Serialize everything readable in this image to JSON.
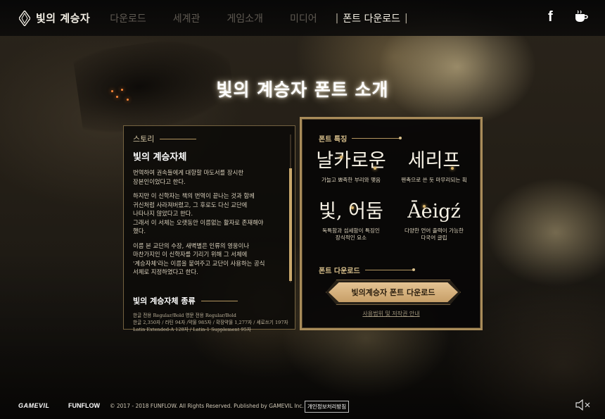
{
  "header": {
    "logo_text": "빛의 계승자",
    "menu": [
      {
        "label": "다운로드"
      },
      {
        "label": "세계관"
      },
      {
        "label": "게임소개"
      },
      {
        "label": "미디어"
      }
    ],
    "active_separator": "|",
    "active_label": "폰트 다운로드",
    "facebook_label": "f"
  },
  "page_title": "빛의 계승자 폰트 소개",
  "story": {
    "heading": "스토리",
    "subtitle": "빛의 계승자체",
    "paragraph_1": "번역하여 권속들에게 대항할 마도서를 장시한\n장본인이었다고 한다.",
    "paragraph_2": "하지만 이 신학자는 책의 번역이 끝나는 것과 함께\n귀신처럼 사라져버렸고, 그 후로도 다신 교단에\n나타나지 않았다고 한다.\n그래서 이 서체는 오랫동안 이름없는 활자로 존재해야\n했다.",
    "paragraph_3": "이름 본 교단의 수장, 새벽별은 인류의 영웅이나\n마찬가지인 이 신학자를 기리기 위해 그 서체에\n'계승자체'라는 이름을 붙여주고 교단이 사용하는 공식\n서체로 지정하였다고 한다."
  },
  "types": {
    "heading": "빛의 계승자체 종류",
    "line_1": "한글 전용 Regular/Bold 영문 전용 Regular/Bold",
    "line_2": "한글 2,350자 / 라틴 94자 /약물 985자 / 확장약물 1,277자 / 세로쓰기 197자",
    "line_3": "Latin Extended-A 128자 / Latin-1 Supplement 95자"
  },
  "features": {
    "heading": "폰트 특징",
    "items": [
      {
        "glyph": "날카로운",
        "desc": "가늘고 뾰족한 부리와 맺음"
      },
      {
        "glyph": "세리프",
        "desc": "펜촉으로 쓴 듯 마무리되는 획"
      },
      {
        "glyph": "빛, 어둠",
        "desc": "독특함과 섬세함이 특징인\n장식적인 요소"
      },
      {
        "glyph": "Āeigź",
        "desc": "다양한 언어 출력이 가능한\n다국어 글립"
      }
    ],
    "download_heading": "폰트 다운로드",
    "download_button": "빛의계승자 폰트 다운로드",
    "license_link": "사용범위 및 저작권 안내"
  },
  "footer": {
    "gamevil": "GAMEVIL",
    "funflow": "FUNFLOW",
    "copyright": "© 2017 - 2018 FUNFLOW. All Rights Reserved. Published by GAMEVIL Inc.",
    "privacy": "개인정보처리방침"
  },
  "colors": {
    "accent_gold": "#c79f68",
    "nav_inactive": "#5f5a52",
    "panel_border": "#a98c5a"
  }
}
